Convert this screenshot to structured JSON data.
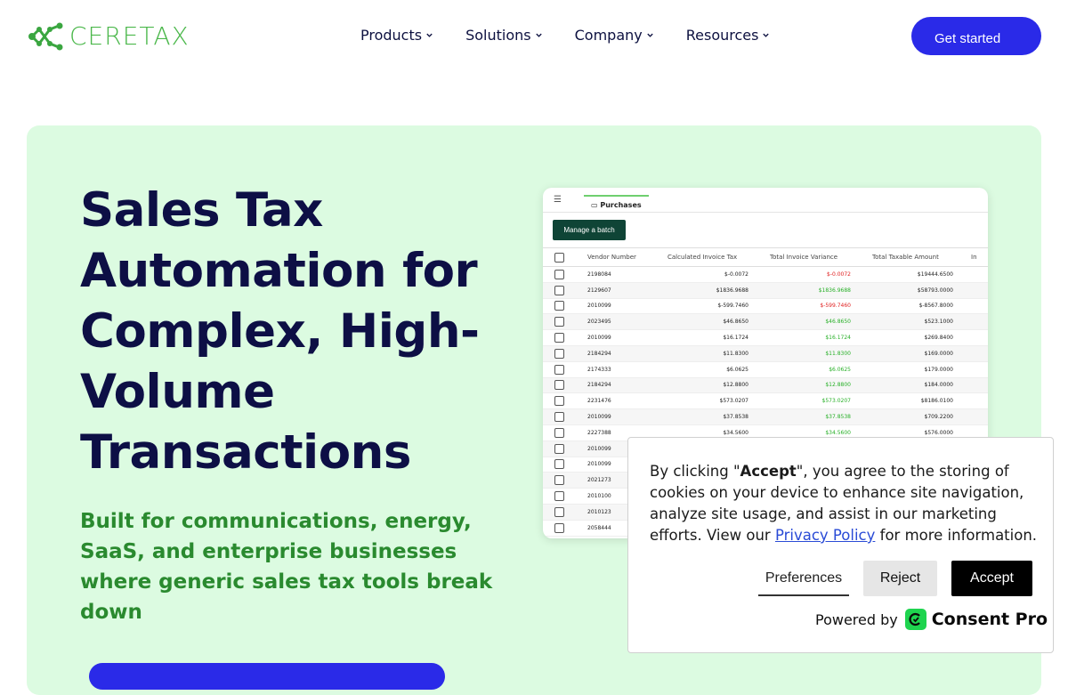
{
  "header": {
    "logo_text": "CERETAX",
    "nav": [
      {
        "label": "Products"
      },
      {
        "label": "Solutions"
      },
      {
        "label": "Company"
      },
      {
        "label": "Resources"
      }
    ],
    "cta_label": "Get started"
  },
  "hero": {
    "title": "Sales Tax Automation for Complex, High-Volume Transactions",
    "subtitle": "Built for communications, energy, SaaS, and enterprise businesses where generic sales tax tools break down"
  },
  "app_preview": {
    "tab_label": "Purchases",
    "batch_button": "Manage a batch",
    "columns": [
      "Vendor Number",
      "Calculated Invoice Tax",
      "Total Invoice Variance",
      "Total Taxable Amount",
      "In"
    ],
    "rows": [
      {
        "vendor": "2198084",
        "tax": "$-0.0072",
        "variance": "$-0.0072",
        "variance_sign": "neg",
        "amount": "$19444.6500"
      },
      {
        "vendor": "2129607",
        "tax": "$1836.9688",
        "variance": "$1836.9688",
        "variance_sign": "pos",
        "amount": "$58793.0000"
      },
      {
        "vendor": "2010099",
        "tax": "$-599.7460",
        "variance": "$-599.7460",
        "variance_sign": "neg",
        "amount": "$-8567.8000"
      },
      {
        "vendor": "2023495",
        "tax": "$46.8650",
        "variance": "$46.8650",
        "variance_sign": "pos",
        "amount": "$523.1000"
      },
      {
        "vendor": "2010099",
        "tax": "$16.1724",
        "variance": "$16.1724",
        "variance_sign": "pos",
        "amount": "$269.8400"
      },
      {
        "vendor": "2184294",
        "tax": "$11.8300",
        "variance": "$11.8300",
        "variance_sign": "pos",
        "amount": "$169.0000"
      },
      {
        "vendor": "2174333",
        "tax": "$6.0625",
        "variance": "$6.0625",
        "variance_sign": "pos",
        "amount": "$179.0000"
      },
      {
        "vendor": "2184294",
        "tax": "$12.8800",
        "variance": "$12.8800",
        "variance_sign": "pos",
        "amount": "$184.0000"
      },
      {
        "vendor": "2231476",
        "tax": "$573.0207",
        "variance": "$573.0207",
        "variance_sign": "pos",
        "amount": "$8186.0100"
      },
      {
        "vendor": "2010099",
        "tax": "$37.8538",
        "variance": "$37.8538",
        "variance_sign": "pos",
        "amount": "$709.2200"
      },
      {
        "vendor": "2227388",
        "tax": "$34.5600",
        "variance": "$34.5600",
        "variance_sign": "pos",
        "amount": "$576.0000"
      },
      {
        "vendor": "2010099",
        "tax": "",
        "variance": "",
        "variance_sign": "pos",
        "amount": ""
      },
      {
        "vendor": "2010099",
        "tax": "",
        "variance": "",
        "variance_sign": "pos",
        "amount": ""
      },
      {
        "vendor": "2021273",
        "tax": "",
        "variance": "",
        "variance_sign": "pos",
        "amount": ""
      },
      {
        "vendor": "2010100",
        "tax": "",
        "variance": "",
        "variance_sign": "pos",
        "amount": ""
      },
      {
        "vendor": "2010123",
        "tax": "",
        "variance": "",
        "variance_sign": "pos",
        "amount": ""
      },
      {
        "vendor": "2058444",
        "tax": "",
        "variance": "",
        "variance_sign": "pos",
        "amount": ""
      }
    ]
  },
  "cookie": {
    "text_before": "By clicking \"",
    "text_bold": "Accept",
    "text_after": "\", you agree to the storing of cookies on your device to enhance site navigation, analyze site usage, and assist in our marketing efforts. View our ",
    "link_label": "Privacy Policy",
    "text_end": " for more information.",
    "preferences_label": "Preferences",
    "reject_label": "Reject",
    "accept_label": "Accept",
    "powered_by": "Powered by",
    "brand": "Consent Pro"
  },
  "colors": {
    "accent_blue": "#2a2ae8",
    "brand_green": "#4cb84c",
    "hero_bg": "#dcfbe1",
    "title_navy": "#0d0f45",
    "subtitle_green": "#2a8a2f"
  }
}
